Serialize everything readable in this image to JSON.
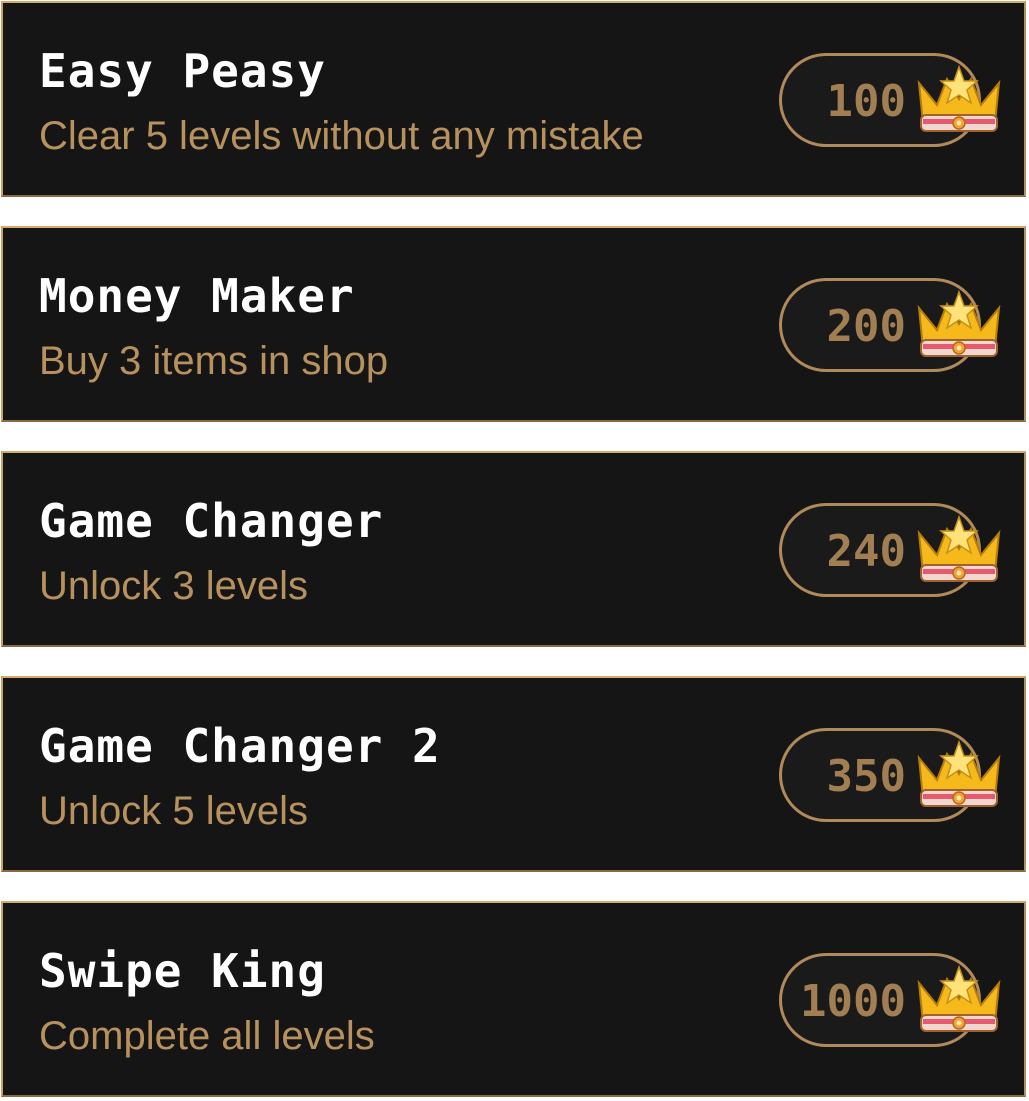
{
  "achievements": [
    {
      "title": "Easy Peasy",
      "description": "Clear 5 levels without any mistake",
      "reward": "100",
      "reward_icon": "crown-icon"
    },
    {
      "title": "Money Maker",
      "description": "Buy 3 items in shop",
      "reward": "200",
      "reward_icon": "crown-icon"
    },
    {
      "title": "Game Changer",
      "description": "Unlock 3 levels",
      "reward": "240",
      "reward_icon": "crown-icon"
    },
    {
      "title": "Game Changer 2",
      "description": "Unlock 5 levels",
      "reward": "350",
      "reward_icon": "crown-icon"
    },
    {
      "title": "Swipe King",
      "description": "Complete all levels",
      "reward": "1000",
      "reward_icon": "crown-icon"
    }
  ],
  "colors": {
    "card_background": "#151515",
    "card_border": "#d6aa6b",
    "title_text": "#ffffff",
    "description_text": "#b8925e",
    "reward_text": "#a27f52",
    "crown_gold": "#f5b91c"
  }
}
